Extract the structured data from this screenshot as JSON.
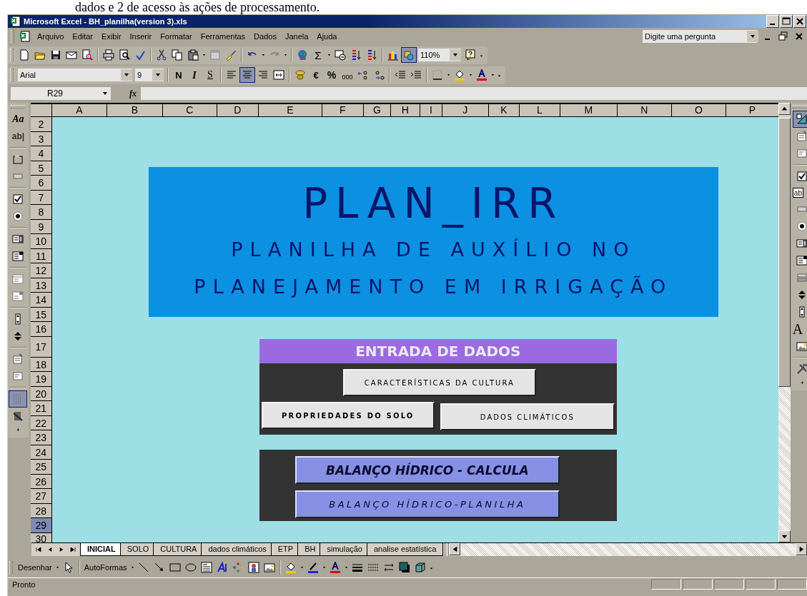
{
  "document_text": "dados e 2 de acesso às ações de processamento.",
  "window": {
    "title": "Microsoft Excel - BH_planilha(version 3).xls"
  },
  "menu": [
    "Arquivo",
    "Editar",
    "Exibir",
    "Inserir",
    "Formatar",
    "Ferramentas",
    "Dados",
    "Janela",
    "Ajuda"
  ],
  "help_box": {
    "placeholder": "Digite uma pergunta"
  },
  "standard_toolbar": {
    "sum": "Σ",
    "zoom": "110%",
    "drawing_selected": true
  },
  "formatting_toolbar": {
    "font": "Arial",
    "size": "9",
    "styles": [
      "N",
      "I",
      "S"
    ],
    "align": [
      {
        "selected": false
      },
      {
        "selected": true
      },
      {
        "selected": false
      }
    ],
    "symbols": [
      "€",
      "%",
      "000"
    ]
  },
  "formula_bar": {
    "name_box": "R29",
    "function_label": "fx"
  },
  "forms_toolbar": {
    "label_glyph": "Aa",
    "edit_glyph": "ab|",
    "grid_selected": true
  },
  "control_toolbox": {
    "design_selected": true,
    "text_glyph": "ab",
    "label_glyph": "A"
  },
  "columns": [
    "A",
    "B",
    "C",
    "D",
    "E",
    "F",
    "G",
    "H",
    "I",
    "J",
    "K",
    "L",
    "M",
    "N",
    "O",
    "P"
  ],
  "rows": [
    {
      "label": "2",
      "selected": false
    },
    {
      "label": "3",
      "selected": false
    },
    {
      "label": "4",
      "selected": false
    },
    {
      "label": "5",
      "selected": false
    },
    {
      "label": "6",
      "selected": false
    },
    {
      "label": "7",
      "selected": false
    },
    {
      "label": "8",
      "selected": false
    },
    {
      "label": "9",
      "selected": false
    },
    {
      "label": "10",
      "selected": false
    },
    {
      "label": "11",
      "selected": false
    },
    {
      "label": "12",
      "selected": false
    },
    {
      "label": "13",
      "selected": false
    },
    {
      "label": "14",
      "selected": false
    },
    {
      "label": "15",
      "selected": false
    },
    {
      "label": "16",
      "selected": false
    },
    {
      "label": "17",
      "selected": false
    },
    {
      "label": "18",
      "selected": false
    },
    {
      "label": "19",
      "selected": false
    },
    {
      "label": "20",
      "selected": false
    },
    {
      "label": "21",
      "selected": false
    },
    {
      "label": "22",
      "selected": false
    },
    {
      "label": "23",
      "selected": false
    },
    {
      "label": "24",
      "selected": false
    },
    {
      "label": "25",
      "selected": false
    },
    {
      "label": "26",
      "selected": false
    },
    {
      "label": "27",
      "selected": false
    },
    {
      "label": "28",
      "selected": false
    },
    {
      "label": "29",
      "selected": true
    },
    {
      "label": "30",
      "selected": false
    }
  ],
  "banner": {
    "title": "PLAN_IRR",
    "subtitle_lines": [
      "PLANILHA DE AUXÍLIO NO",
      "PLANEJAMENTO EM IRRIGAÇÃO"
    ]
  },
  "data_entry": {
    "heading": "ENTRADA DE DADOS",
    "buttons": [
      "CARACTERÍSTICAS DA CULTURA",
      "PROPRIEDADES DO SOLO",
      "DADOS CLIMÁTICOS"
    ]
  },
  "processing": {
    "buttons": [
      "BALANÇO HÍDRICO - CALCULA",
      "BALANÇO HÍDRICO-PLANILHA"
    ]
  },
  "sheet_tabs": [
    {
      "label": "INICIAL",
      "selected": true
    },
    {
      "label": "SOLO",
      "selected": false
    },
    {
      "label": "CULTURA",
      "selected": false
    },
    {
      "label": "dados climáticos",
      "selected": false
    },
    {
      "label": "ETP",
      "selected": false
    },
    {
      "label": "BH",
      "selected": false
    },
    {
      "label": "simulação",
      "selected": false
    },
    {
      "label": "analise estatística",
      "selected": false
    }
  ],
  "drawing_toolbar": {
    "draw_menu": "Desenhar",
    "autoshapes_menu": "AutoFormas"
  },
  "status_bar": {
    "text": "Pronto"
  }
}
